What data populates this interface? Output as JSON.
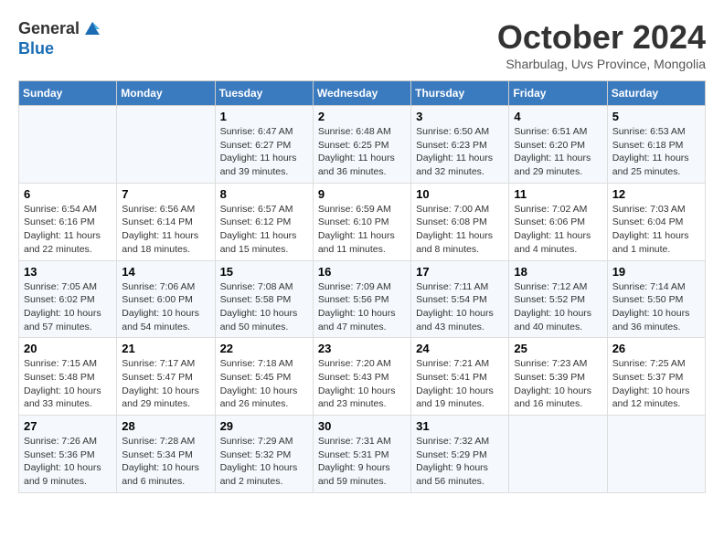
{
  "logo": {
    "general": "General",
    "blue": "Blue"
  },
  "title": "October 2024",
  "location": "Sharbulag, Uvs Province, Mongolia",
  "weekdays": [
    "Sunday",
    "Monday",
    "Tuesday",
    "Wednesday",
    "Thursday",
    "Friday",
    "Saturday"
  ],
  "weeks": [
    [
      {
        "day": "",
        "info": ""
      },
      {
        "day": "",
        "info": ""
      },
      {
        "day": "1",
        "info": "Sunrise: 6:47 AM\nSunset: 6:27 PM\nDaylight: 11 hours and 39 minutes."
      },
      {
        "day": "2",
        "info": "Sunrise: 6:48 AM\nSunset: 6:25 PM\nDaylight: 11 hours and 36 minutes."
      },
      {
        "day": "3",
        "info": "Sunrise: 6:50 AM\nSunset: 6:23 PM\nDaylight: 11 hours and 32 minutes."
      },
      {
        "day": "4",
        "info": "Sunrise: 6:51 AM\nSunset: 6:20 PM\nDaylight: 11 hours and 29 minutes."
      },
      {
        "day": "5",
        "info": "Sunrise: 6:53 AM\nSunset: 6:18 PM\nDaylight: 11 hours and 25 minutes."
      }
    ],
    [
      {
        "day": "6",
        "info": "Sunrise: 6:54 AM\nSunset: 6:16 PM\nDaylight: 11 hours and 22 minutes."
      },
      {
        "day": "7",
        "info": "Sunrise: 6:56 AM\nSunset: 6:14 PM\nDaylight: 11 hours and 18 minutes."
      },
      {
        "day": "8",
        "info": "Sunrise: 6:57 AM\nSunset: 6:12 PM\nDaylight: 11 hours and 15 minutes."
      },
      {
        "day": "9",
        "info": "Sunrise: 6:59 AM\nSunset: 6:10 PM\nDaylight: 11 hours and 11 minutes."
      },
      {
        "day": "10",
        "info": "Sunrise: 7:00 AM\nSunset: 6:08 PM\nDaylight: 11 hours and 8 minutes."
      },
      {
        "day": "11",
        "info": "Sunrise: 7:02 AM\nSunset: 6:06 PM\nDaylight: 11 hours and 4 minutes."
      },
      {
        "day": "12",
        "info": "Sunrise: 7:03 AM\nSunset: 6:04 PM\nDaylight: 11 hours and 1 minute."
      }
    ],
    [
      {
        "day": "13",
        "info": "Sunrise: 7:05 AM\nSunset: 6:02 PM\nDaylight: 10 hours and 57 minutes."
      },
      {
        "day": "14",
        "info": "Sunrise: 7:06 AM\nSunset: 6:00 PM\nDaylight: 10 hours and 54 minutes."
      },
      {
        "day": "15",
        "info": "Sunrise: 7:08 AM\nSunset: 5:58 PM\nDaylight: 10 hours and 50 minutes."
      },
      {
        "day": "16",
        "info": "Sunrise: 7:09 AM\nSunset: 5:56 PM\nDaylight: 10 hours and 47 minutes."
      },
      {
        "day": "17",
        "info": "Sunrise: 7:11 AM\nSunset: 5:54 PM\nDaylight: 10 hours and 43 minutes."
      },
      {
        "day": "18",
        "info": "Sunrise: 7:12 AM\nSunset: 5:52 PM\nDaylight: 10 hours and 40 minutes."
      },
      {
        "day": "19",
        "info": "Sunrise: 7:14 AM\nSunset: 5:50 PM\nDaylight: 10 hours and 36 minutes."
      }
    ],
    [
      {
        "day": "20",
        "info": "Sunrise: 7:15 AM\nSunset: 5:48 PM\nDaylight: 10 hours and 33 minutes."
      },
      {
        "day": "21",
        "info": "Sunrise: 7:17 AM\nSunset: 5:47 PM\nDaylight: 10 hours and 29 minutes."
      },
      {
        "day": "22",
        "info": "Sunrise: 7:18 AM\nSunset: 5:45 PM\nDaylight: 10 hours and 26 minutes."
      },
      {
        "day": "23",
        "info": "Sunrise: 7:20 AM\nSunset: 5:43 PM\nDaylight: 10 hours and 23 minutes."
      },
      {
        "day": "24",
        "info": "Sunrise: 7:21 AM\nSunset: 5:41 PM\nDaylight: 10 hours and 19 minutes."
      },
      {
        "day": "25",
        "info": "Sunrise: 7:23 AM\nSunset: 5:39 PM\nDaylight: 10 hours and 16 minutes."
      },
      {
        "day": "26",
        "info": "Sunrise: 7:25 AM\nSunset: 5:37 PM\nDaylight: 10 hours and 12 minutes."
      }
    ],
    [
      {
        "day": "27",
        "info": "Sunrise: 7:26 AM\nSunset: 5:36 PM\nDaylight: 10 hours and 9 minutes."
      },
      {
        "day": "28",
        "info": "Sunrise: 7:28 AM\nSunset: 5:34 PM\nDaylight: 10 hours and 6 minutes."
      },
      {
        "day": "29",
        "info": "Sunrise: 7:29 AM\nSunset: 5:32 PM\nDaylight: 10 hours and 2 minutes."
      },
      {
        "day": "30",
        "info": "Sunrise: 7:31 AM\nSunset: 5:31 PM\nDaylight: 9 hours and 59 minutes."
      },
      {
        "day": "31",
        "info": "Sunrise: 7:32 AM\nSunset: 5:29 PM\nDaylight: 9 hours and 56 minutes."
      },
      {
        "day": "",
        "info": ""
      },
      {
        "day": "",
        "info": ""
      }
    ]
  ]
}
